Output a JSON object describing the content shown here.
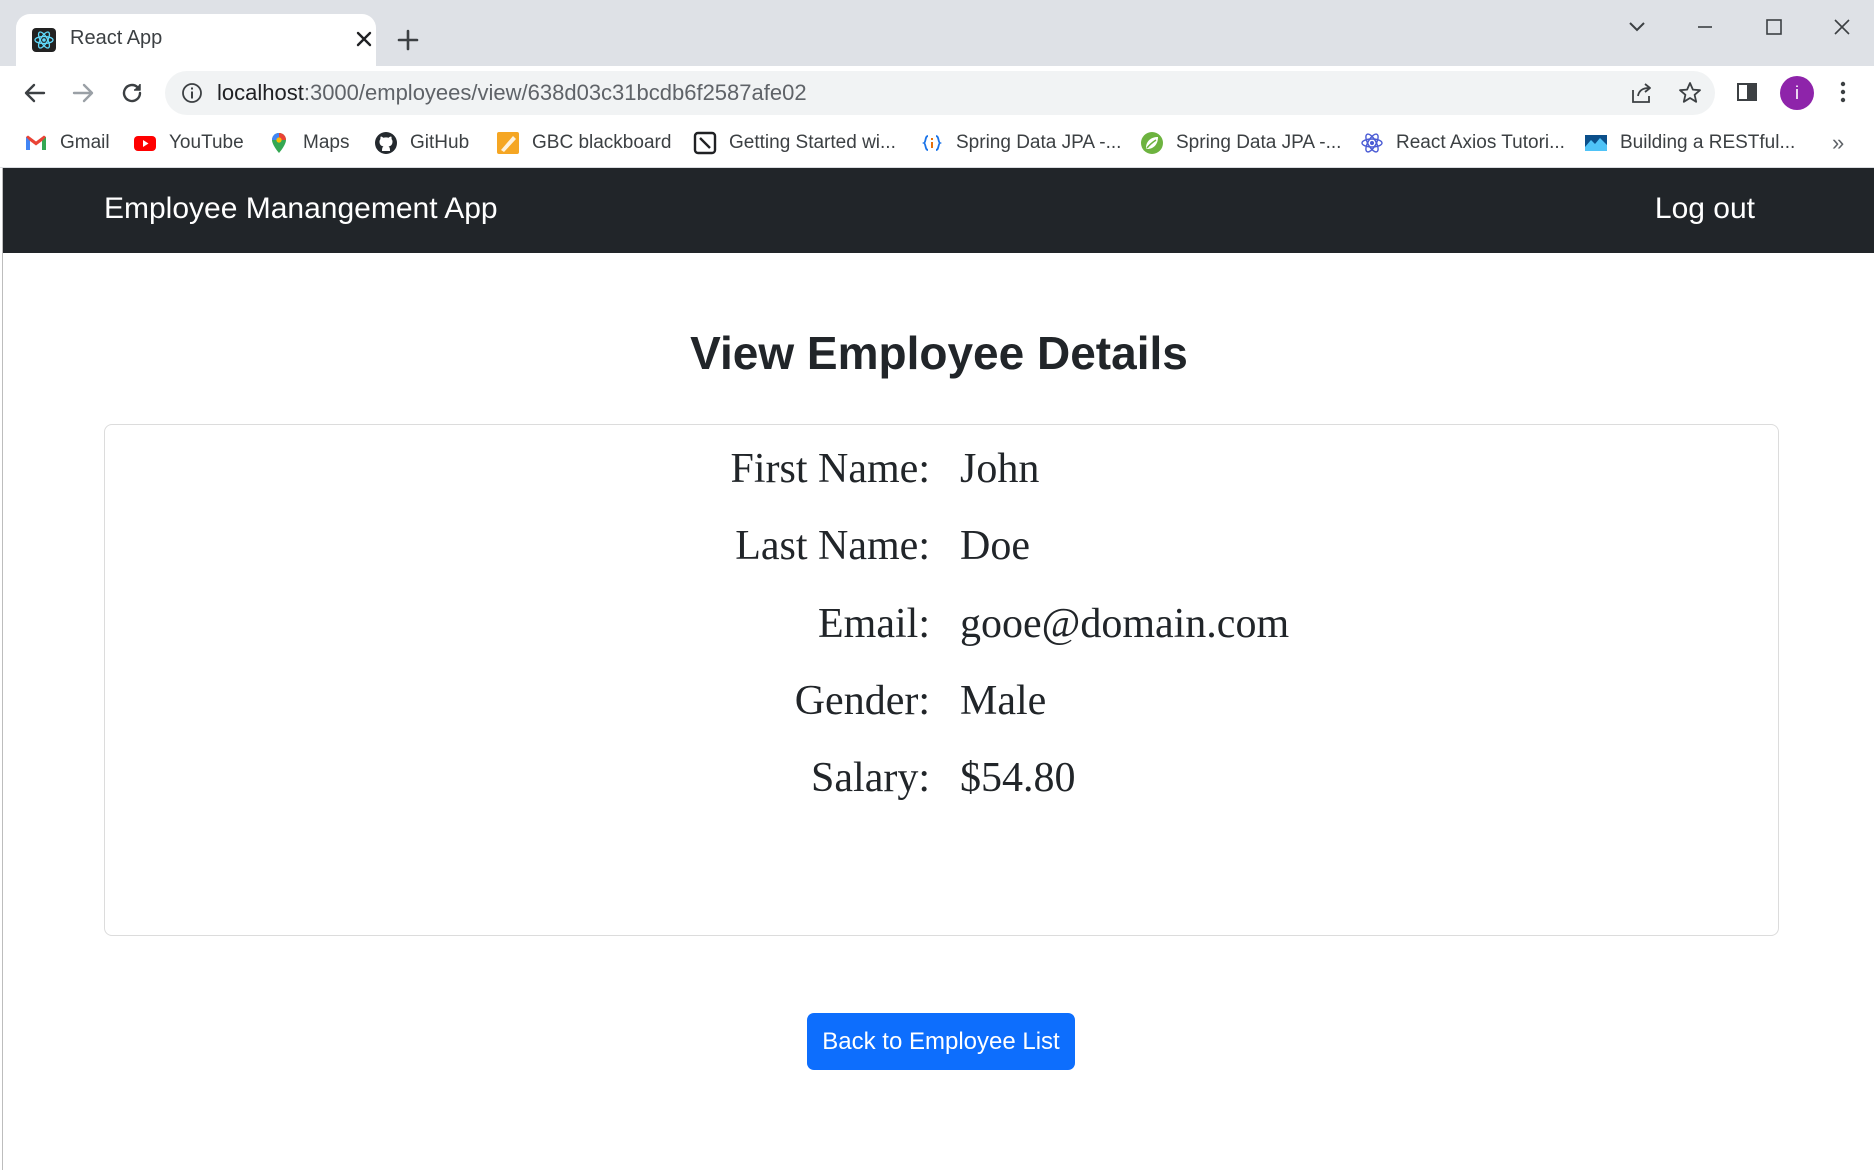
{
  "browser": {
    "tab_title": "React App",
    "url_host": "localhost",
    "url_path": ":3000/employees/view/638d03c31bcdb6f2587afe02",
    "profile_initial": "i",
    "bookmarks": [
      {
        "label": "Gmail",
        "icon": "gmail-icon"
      },
      {
        "label": "YouTube",
        "icon": "youtube-icon"
      },
      {
        "label": "Maps",
        "icon": "maps-icon"
      },
      {
        "label": "GitHub",
        "icon": "github-icon"
      },
      {
        "label": "GBC blackboard",
        "icon": "blackboard-icon"
      },
      {
        "label": "Getting Started wi...",
        "icon": "getting-started-icon"
      },
      {
        "label": "Spring Data JPA -...",
        "icon": "code-braces-icon"
      },
      {
        "label": "Spring Data JPA -...",
        "icon": "spring-leaf-icon"
      },
      {
        "label": "React Axios Tutori...",
        "icon": "react-icon"
      },
      {
        "label": "Building a RESTful...",
        "icon": "landscape-icon"
      }
    ],
    "more_bookmarks": "»"
  },
  "navbar": {
    "brand": "Employee Manangement App",
    "logout": "Log out"
  },
  "main": {
    "title": "View Employee Details",
    "fields": [
      {
        "label": "First Name:",
        "value": "John"
      },
      {
        "label": "Last Name:",
        "value": "Doe"
      },
      {
        "label": "Email:",
        "value": "gooe@domain.com"
      },
      {
        "label": "Gender:",
        "value": "Male"
      },
      {
        "label": "Salary:",
        "value": "$54.80"
      }
    ],
    "back_button": "Back to Employee List"
  },
  "colors": {
    "navbar_bg": "#212529",
    "primary_button": "#0d6efd",
    "tabstrip_bg": "#dee1e6",
    "avatar_bg": "#8e24aa"
  }
}
